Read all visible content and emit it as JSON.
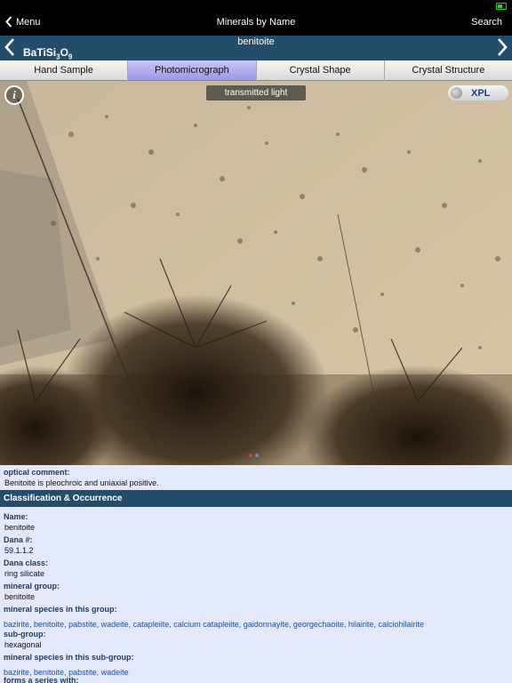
{
  "nav": {
    "back_label": "Menu",
    "title": "Minerals by Name",
    "search_label": "Search"
  },
  "mineral": {
    "name": "benitoite",
    "formula_parts": [
      "BaTiSi",
      "3",
      "O",
      "9"
    ]
  },
  "tabs": [
    {
      "label": "Hand Sample",
      "active": false
    },
    {
      "label": "Photomicrograph",
      "active": true
    },
    {
      "label": "Crystal Shape",
      "active": false
    },
    {
      "label": "Crystal Structure",
      "active": false
    }
  ],
  "photo": {
    "light_mode": "transmitted light",
    "polarization_toggle": "XPL",
    "info_icon": "info-icon"
  },
  "optical": {
    "label": "optical comment:",
    "text": "Benitoite is pleochroic and uniaxial positive."
  },
  "section": {
    "title": "Classification & Occurrence"
  },
  "fields": {
    "name": {
      "label": "Name:",
      "value": "benitoite"
    },
    "dana_num": {
      "label": "Dana #:",
      "value": "59.1.1.2"
    },
    "dana_class": {
      "label": "Dana class:",
      "value": "ring silicate"
    },
    "group": {
      "label": "mineral group:",
      "value": "benitoite"
    },
    "species_group": {
      "label": "mineral species in this group:",
      "items": [
        "bazirite",
        "benitoite",
        "pabstite",
        "wadeite",
        "catapleiite",
        "calcium catapleiite",
        "gaidonnayite",
        "georgechaoite",
        "hilairite",
        "calciohilairite"
      ]
    },
    "subgroup": {
      "label": "sub-group:",
      "value": "hexagonal"
    },
    "species_subgroup": {
      "label": "mineral species in this sub-group:",
      "items": [
        "bazirite",
        "benitoite",
        "pabstite",
        "wadeite"
      ]
    },
    "series": {
      "label": "forms a series with:"
    }
  },
  "colors": {
    "header_blue": "#234d6b",
    "panel_bg": "#e4e8fb",
    "active_tab": "#9b97e8",
    "link": "#1f4f8f"
  }
}
